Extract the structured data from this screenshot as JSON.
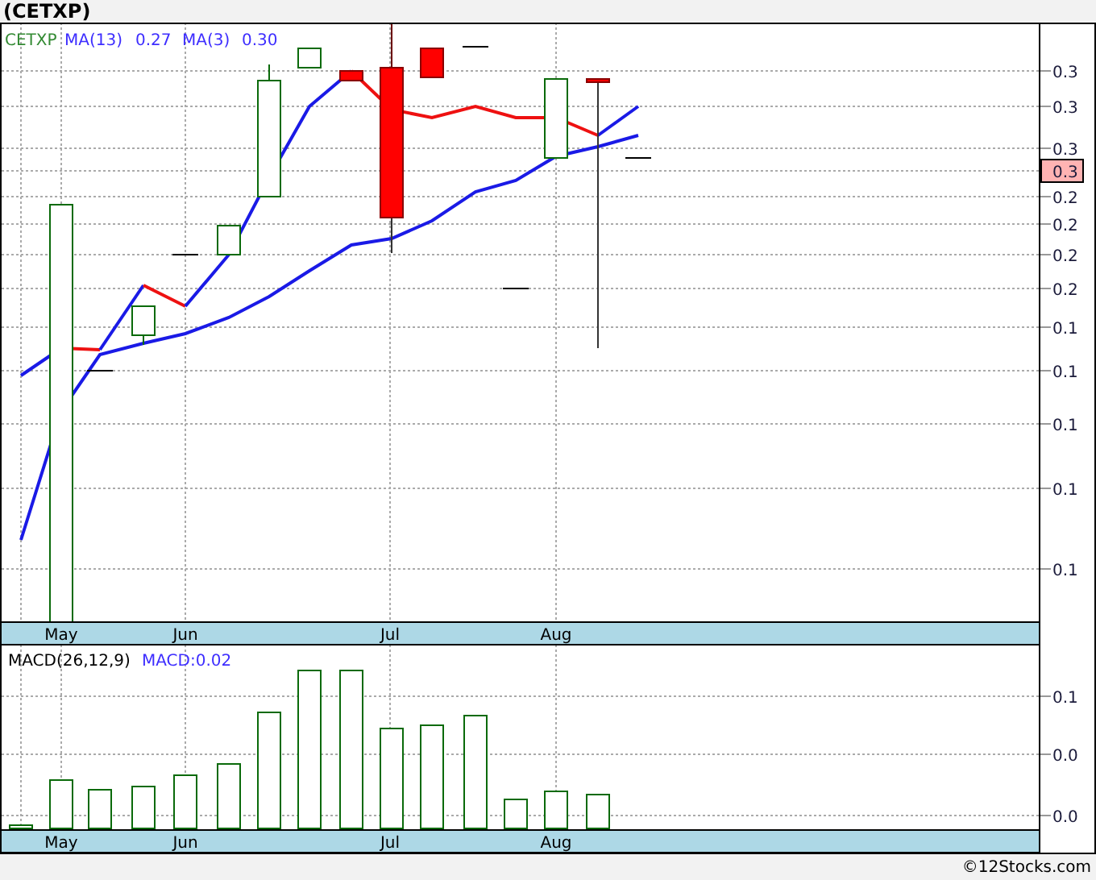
{
  "title": "(CETXP)",
  "legend": [
    {
      "text": "CETXP",
      "kind": "symbol"
    },
    {
      "text": "MA(13)",
      "kind": "ma"
    },
    {
      "text": "0.27",
      "kind": "ma"
    },
    {
      "text": "MA(3)",
      "kind": "ma"
    },
    {
      "text": "0.30",
      "kind": "ma"
    }
  ],
  "price_axis": [
    {
      "label": "0.3",
      "highlighted": false
    },
    {
      "label": "0.3",
      "highlighted": false
    },
    {
      "label": "0.3",
      "highlighted": false
    },
    {
      "label": "0.3",
      "highlighted": true
    },
    {
      "label": "0.2",
      "highlighted": false
    },
    {
      "label": "0.2",
      "highlighted": false
    },
    {
      "label": "0.2",
      "highlighted": false
    },
    {
      "label": "0.2",
      "highlighted": false
    },
    {
      "label": "0.1",
      "highlighted": false
    },
    {
      "label": "0.1",
      "highlighted": false
    },
    {
      "label": "0.1",
      "highlighted": false
    },
    {
      "label": "0.1",
      "highlighted": false
    },
    {
      "label": "0.1",
      "highlighted": false
    }
  ],
  "months_top": [
    "May",
    "Jun",
    "Jul",
    "Aug"
  ],
  "macd_legend": [
    {
      "text": "MACD(26,12,9)",
      "kind": "name"
    },
    {
      "text": "MACD:0.02",
      "kind": "value"
    }
  ],
  "macd_axis": [
    "0.1",
    "0.0",
    "0.0"
  ],
  "months_bottom": [
    "May",
    "Jun",
    "Jul",
    "Aug"
  ],
  "credit": "©12Stocks.com"
}
